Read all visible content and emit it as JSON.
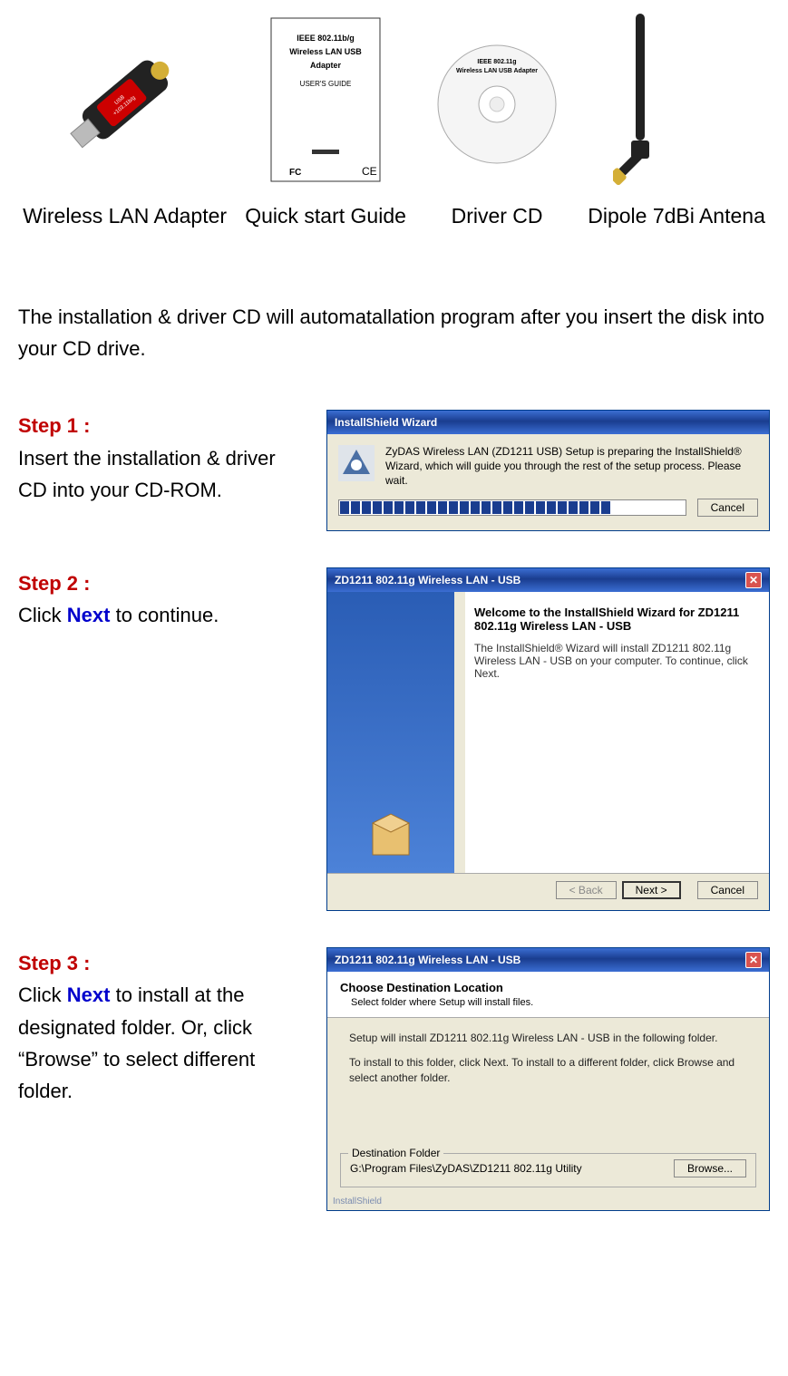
{
  "package": {
    "items": [
      {
        "label": "Wireless LAN Adapter"
      },
      {
        "label": "Quick start Guide"
      },
      {
        "label": "Driver CD"
      },
      {
        "label": "Dipole 7dBi Antena"
      }
    ],
    "guide": {
      "line1": "IEEE 802.11b/g",
      "line2": "Wireless LAN USB",
      "line3": "Adapter",
      "line4": "USER'S GUIDE"
    },
    "cd": {
      "line1": "IEEE 802.11g",
      "line2": "Wireless LAN USB Adapter"
    },
    "adapter": {
      "text1": "USB",
      "text2": "+103.11b/g"
    }
  },
  "intro": "The installation & driver CD will automatallation program after you insert the disk into your CD drive.",
  "steps": {
    "s1": {
      "label": "Step 1 :",
      "body": "Insert the installation & driver CD into your CD-ROM."
    },
    "s2": {
      "label": "Step 2 :",
      "body_pre": "Click ",
      "next": "Next",
      "body_post": " to continue."
    },
    "s3": {
      "label": "Step 3 :",
      "body_pre": "Click ",
      "next": "Next",
      "body_post": " to install at the designated folder. Or, click “Browse” to select different folder."
    }
  },
  "dialog1": {
    "title": "InstallShield Wizard",
    "text": "ZyDAS Wireless LAN (ZD1211 USB) Setup is preparing the InstallShield® Wizard, which will guide you through the rest of the setup process. Please wait.",
    "cancel": "Cancel"
  },
  "dialog2": {
    "title": "ZD1211 802.11g Wireless LAN - USB",
    "welcome": "Welcome to the InstallShield Wizard for ZD1211 802.11g Wireless LAN - USB",
    "text": "The InstallShield® Wizard will install ZD1211 802.11g Wireless LAN - USB on your computer. To continue, click Next.",
    "back": "< Back",
    "next": "Next >",
    "cancel": "Cancel"
  },
  "dialog3": {
    "title": "ZD1211 802.11g Wireless LAN - USB",
    "head": "Choose Destination Location",
    "sub": "Select folder where Setup will install files.",
    "body1": "Setup will install ZD1211 802.11g Wireless LAN - USB in the following folder.",
    "body2": "To install to this folder, click Next. To install to a different folder, click Browse and select another folder.",
    "dest_label": "Destination Folder",
    "dest_path": "G:\\Program Files\\ZyDAS\\ZD1211 802.11g Utility",
    "browse": "Browse...",
    "status": "InstallShield"
  }
}
